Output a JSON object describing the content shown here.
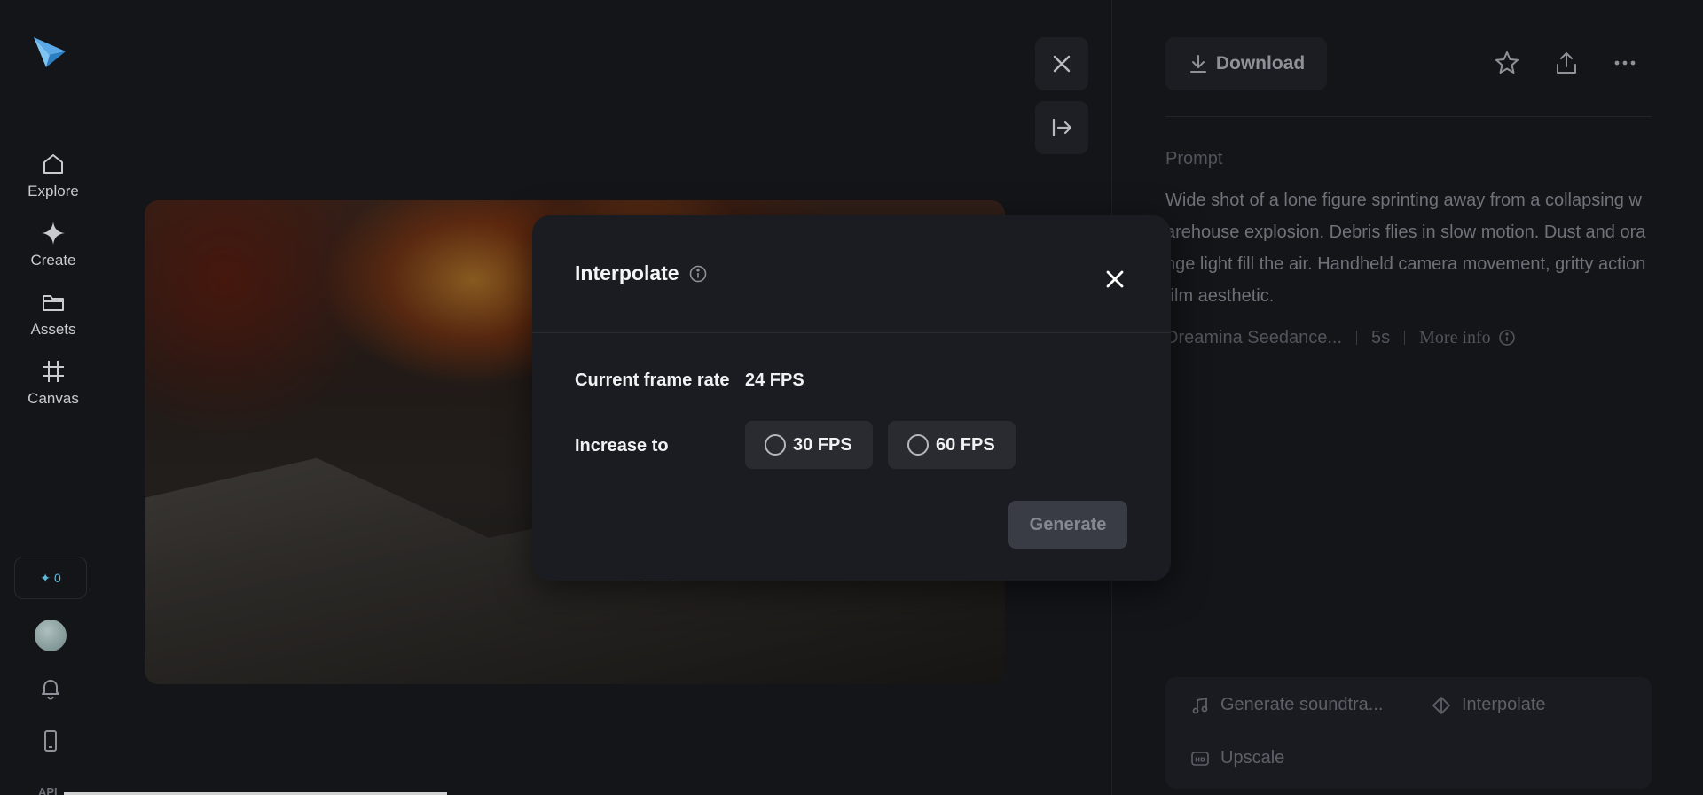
{
  "sidebar": {
    "logo_icon": "paper-plane-logo",
    "items": [
      {
        "label": "Explore",
        "icon": "home-icon"
      },
      {
        "label": "Create",
        "icon": "sparkle-icon"
      },
      {
        "label": "Assets",
        "icon": "folder-icon"
      },
      {
        "label": "Canvas",
        "icon": "crop-icon"
      }
    ],
    "credits": "0",
    "api_label": "API"
  },
  "right_panel": {
    "download_label": "Download",
    "prompt_title": "Prompt",
    "prompt_text": "Wide shot of a lone figure sprinting away from a collapsing warehouse explosion. Debris flies in slow motion. Dust and orange light fill the air. Handheld camera movement, gritty action film aesthetic.",
    "model": "Dreamina Seedance...",
    "duration": "5s",
    "more_info": "More info",
    "tools": {
      "soundtrack": "Generate soundtra...",
      "interpolate": "Interpolate",
      "upscale": "Upscale"
    }
  },
  "modal": {
    "title": "Interpolate",
    "current_label": "Current frame rate",
    "current_value": "24 FPS",
    "increase_label": "Increase to",
    "options": [
      "30 FPS",
      "60 FPS"
    ],
    "generate_label": "Generate"
  },
  "colors": {
    "background": "#141519",
    "modal": "#1b1c21",
    "accent": "#5fb8d8"
  }
}
